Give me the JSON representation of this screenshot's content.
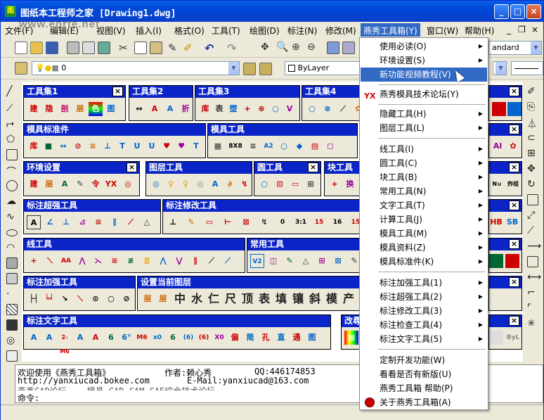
{
  "window": {
    "title": "图纸本工程师之家 [Drawing1.dwg]",
    "watermark": "www.eorte.net",
    "controls": {
      "minimize": "_",
      "maximize": "□",
      "close": "×"
    }
  },
  "menubar": {
    "items": [
      "文件(F)",
      "编辑(E)",
      "视图(V)",
      "插入(I)",
      "格式(O)",
      "工具(T)",
      "绘图(D)",
      "标注(N)",
      "修改(M)",
      "燕秀工具箱(Y)",
      "窗口(W)",
      "帮助(H)"
    ],
    "active": "燕秀工具箱(Y)",
    "mdi_controls": {
      "minimize": "_",
      "restore": "❐",
      "close": "×"
    }
  },
  "toolbar2": {
    "layer_value": "0",
    "color_value": "ByLayer",
    "textstyle_value": "andard"
  },
  "panels": [
    {
      "title": "工具集1",
      "glyphs": [
        "建",
        "隐",
        "剖",
        "层",
        "色",
        "图"
      ]
    },
    {
      "title": "工具集2",
      "glyphs": [
        "↔",
        "A",
        "A",
        "折"
      ]
    },
    {
      "title": "工具集3",
      "glyphs": [
        "库",
        "表",
        "塑",
        "+",
        "⊕",
        "○",
        "V"
      ]
    },
    {
      "title": "工具集4",
      "glyphs": [
        "○",
        "⊗",
        "⟋",
        "✿"
      ]
    },
    {
      "title": "模具标准件",
      "glyphs": [
        "库",
        "■",
        "↔",
        "⊘",
        "≡",
        "⊥",
        "T",
        "U",
        "U",
        "♥",
        "♥",
        "T"
      ]
    },
    {
      "title": "模具工具",
      "glyphs": [
        "▦",
        "8X8",
        "≡",
        "A2",
        "○",
        "◆",
        "▤",
        "◻"
      ]
    },
    {
      "title": "环境设置",
      "glyphs": [
        "建",
        "层",
        "A",
        "✎",
        "令",
        "YX",
        "◎"
      ]
    },
    {
      "title": "图层工具",
      "glyphs": [
        "◎",
        "♀",
        "♀",
        "◎",
        "A",
        "∂",
        "↯"
      ]
    },
    {
      "title": "圆工具",
      "glyphs": [
        "○",
        "⊡",
        "▭",
        "⊞"
      ]
    },
    {
      "title": "块工具",
      "glyphs": [
        "+",
        "换"
      ]
    },
    {
      "title": "标注超强工具",
      "glyphs": [
        "A",
        "∠",
        "⊥",
        "⊿",
        "≡",
        "∥",
        "⟋",
        "△"
      ]
    },
    {
      "title": "标注修改工具",
      "glyphs": [
        "⊥",
        "✎",
        "▭",
        "⊢",
        "⊠",
        "↯",
        "0",
        "3:1",
        "15",
        "16",
        "15"
      ]
    },
    {
      "title": "线工具",
      "glyphs": [
        "+",
        "⟍",
        "AA",
        "⋀",
        "⋋",
        "≡",
        "≢",
        "≣",
        "⋀",
        "⋁",
        "∥",
        "⟋",
        "⟋"
      ]
    },
    {
      "title": "常用工具",
      "glyphs": [
        "V2",
        "◫",
        "✎",
        "△",
        "⊞",
        "⊠",
        "✎"
      ]
    },
    {
      "title": "标注加强工具",
      "glyphs": [
        "├┤",
        "╘╛",
        "↘",
        "⟍",
        "⊙",
        "○",
        "⊘"
      ]
    },
    {
      "title": "设置当前图层",
      "glyphs": [
        "层",
        "层",
        "中",
        "水",
        "仁",
        "尺",
        "顶",
        "表",
        "填",
        "镶",
        "斜",
        "模",
        "产",
        "流"
      ]
    },
    {
      "title": "标注文字工具",
      "glyphs": [
        "A",
        "A",
        "2-M6",
        "A",
        "A",
        "6",
        "6°",
        "M6",
        "x0",
        "6",
        "(6)",
        "(6)",
        "X0",
        "偏",
        "简",
        "孔",
        "直",
        "通",
        "图"
      ]
    },
    {
      "title": "改尋",
      "glyphs": [
        "▦"
      ]
    }
  ],
  "right_glyphs": [
    "HB",
    "SB",
    "AI",
    "N∪",
    "炸组",
    "ByL"
  ],
  "command": {
    "line1_left": "欢迎使用《燕秀工具箱》",
    "line1_mid": "作者:赖心秀",
    "line1_right": "QQ:446174853",
    "line2_left": "http://yanxiucad.bokee.com",
    "line2_right": "E-Mail:yanxiucad@163.com",
    "line3": "燕秀CAD论坛...                   模具 CAD,CAM,CAE综合技术论坛",
    "prompt": "命令:"
  },
  "dropdown": {
    "items": [
      {
        "label": "使用必读(O)",
        "submenu": true
      },
      {
        "label": "环境设置(S)",
        "submenu": true
      },
      {
        "label": "新功能视频教程(V)",
        "submenu": false,
        "highlighted": true
      },
      {
        "label": "燕秀模具技术论坛(Y)",
        "submenu": false,
        "icon": "YX"
      },
      {
        "label": "隐藏工具(H)",
        "submenu": true
      },
      {
        "label": "图层工具(L)",
        "submenu": true
      },
      {
        "label": "线工具(I)",
        "submenu": true
      },
      {
        "label": "圆工具(C)",
        "submenu": true
      },
      {
        "label": "块工具(B)",
        "submenu": true
      },
      {
        "label": "常用工具(N)",
        "submenu": true
      },
      {
        "label": "文字工具(T)",
        "submenu": true
      },
      {
        "label": "计算工具(J)",
        "submenu": true
      },
      {
        "label": "模具工具(M)",
        "submenu": true
      },
      {
        "label": "模具资料(Z)",
        "submenu": true
      },
      {
        "label": "模具标准件(K)",
        "submenu": true
      },
      {
        "label": "标注加强工具(1)",
        "submenu": true
      },
      {
        "label": "标注超强工具(2)",
        "submenu": true
      },
      {
        "label": "标注修改工具(3)",
        "submenu": true
      },
      {
        "label": "标注检查工具(4)",
        "submenu": true
      },
      {
        "label": "标注文字工具(5)",
        "submenu": true
      },
      {
        "label": "定制开发功能(W)",
        "submenu": false
      },
      {
        "label": "看看是否有新版(U)",
        "submenu": false
      },
      {
        "label": "燕秀工具箱 帮助(P)",
        "submenu": false
      },
      {
        "label": "关于燕秀工具箱(A)",
        "submenu": false,
        "icon": "logo"
      }
    ],
    "submenu_arrow": "▶"
  },
  "colors": {
    "title_blue": "#0a5ce6",
    "panel_title": "#0a24c8",
    "menu_highlight": "#316ac5",
    "xp_face": "#ece9d8"
  }
}
